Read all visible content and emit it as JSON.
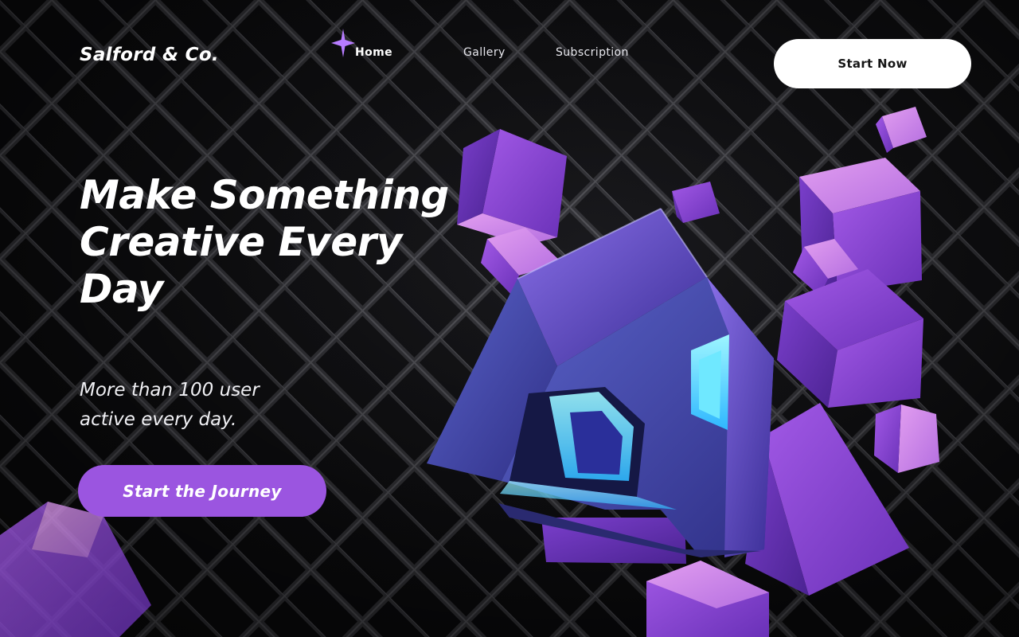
{
  "header": {
    "logo": "Salford & Co.",
    "nav": [
      {
        "label": "Home",
        "active": true
      },
      {
        "label": "Gallery",
        "active": false
      },
      {
        "label": "Subscription",
        "active": false
      }
    ],
    "cta_label": "Start Now"
  },
  "hero": {
    "title_lines": [
      "Make Something",
      "Creative Every",
      "Day"
    ],
    "subtitle_lines": [
      "More than 100 user",
      "active every day."
    ],
    "button_label": "Start the Journey"
  },
  "icons": {
    "active_nav_indicator": "sparkle-icon"
  },
  "colors": {
    "background": "#0b0b0d",
    "accent_purple": "#9b55e0",
    "sparkle": "#b77cff",
    "cube_purple": "#8a4bd6",
    "cube_blue": "#3b3f9c",
    "glow_cyan": "#5ee7ff",
    "button_white": "#ffffff"
  }
}
